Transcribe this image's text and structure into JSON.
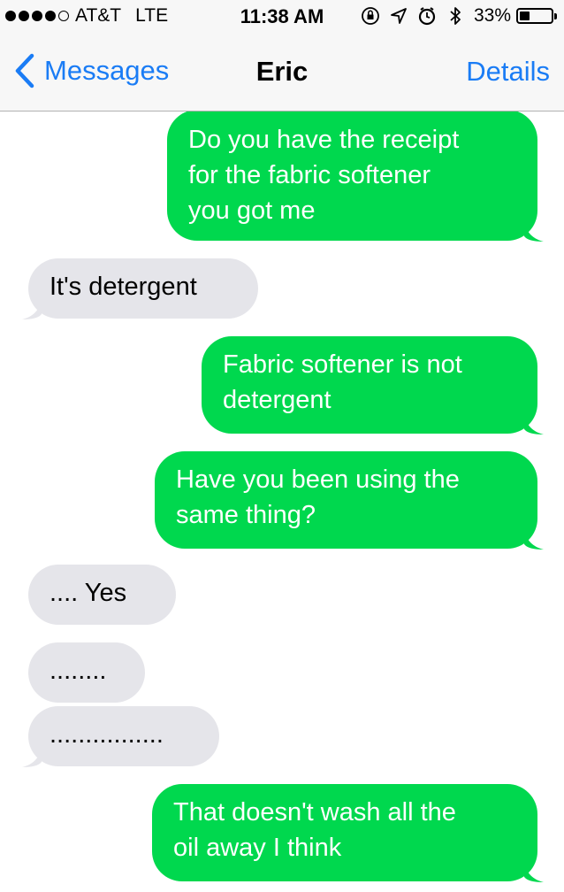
{
  "status_bar": {
    "carrier": "AT&T",
    "network": "LTE",
    "time": "11:38 AM",
    "battery_percent": "33%",
    "battery_level": 0.33,
    "signal_bars_filled": 4,
    "signal_bars_total": 5,
    "icons": [
      "orientation-lock-icon",
      "location-arrow-icon",
      "alarm-icon",
      "bluetooth-icon",
      "battery-icon"
    ]
  },
  "nav": {
    "back_label": "Messages",
    "title": "Eric",
    "details_label": "Details"
  },
  "colors": {
    "sent_bubble": "#00d84e",
    "received_bubble": "#e5e5ea",
    "accent": "#1a7cf5"
  },
  "messages": [
    {
      "direction": "sent",
      "lines": [
        "Do you have the receipt",
        "for the fabric softener",
        "you got me"
      ]
    },
    {
      "direction": "received",
      "lines": [
        "It's detergent"
      ]
    },
    {
      "direction": "sent",
      "lines": [
        "Fabric softener is not",
        "detergent"
      ]
    },
    {
      "direction": "sent",
      "lines": [
        "Have you been using the",
        "same thing?"
      ]
    },
    {
      "direction": "received",
      "lines": [
        ".... Yes"
      ]
    },
    {
      "direction": "received",
      "lines": [
        "........"
      ]
    },
    {
      "direction": "received",
      "lines": [
        "................"
      ]
    },
    {
      "direction": "sent",
      "lines": [
        "That doesn't wash all the",
        "oil away I think"
      ]
    }
  ]
}
